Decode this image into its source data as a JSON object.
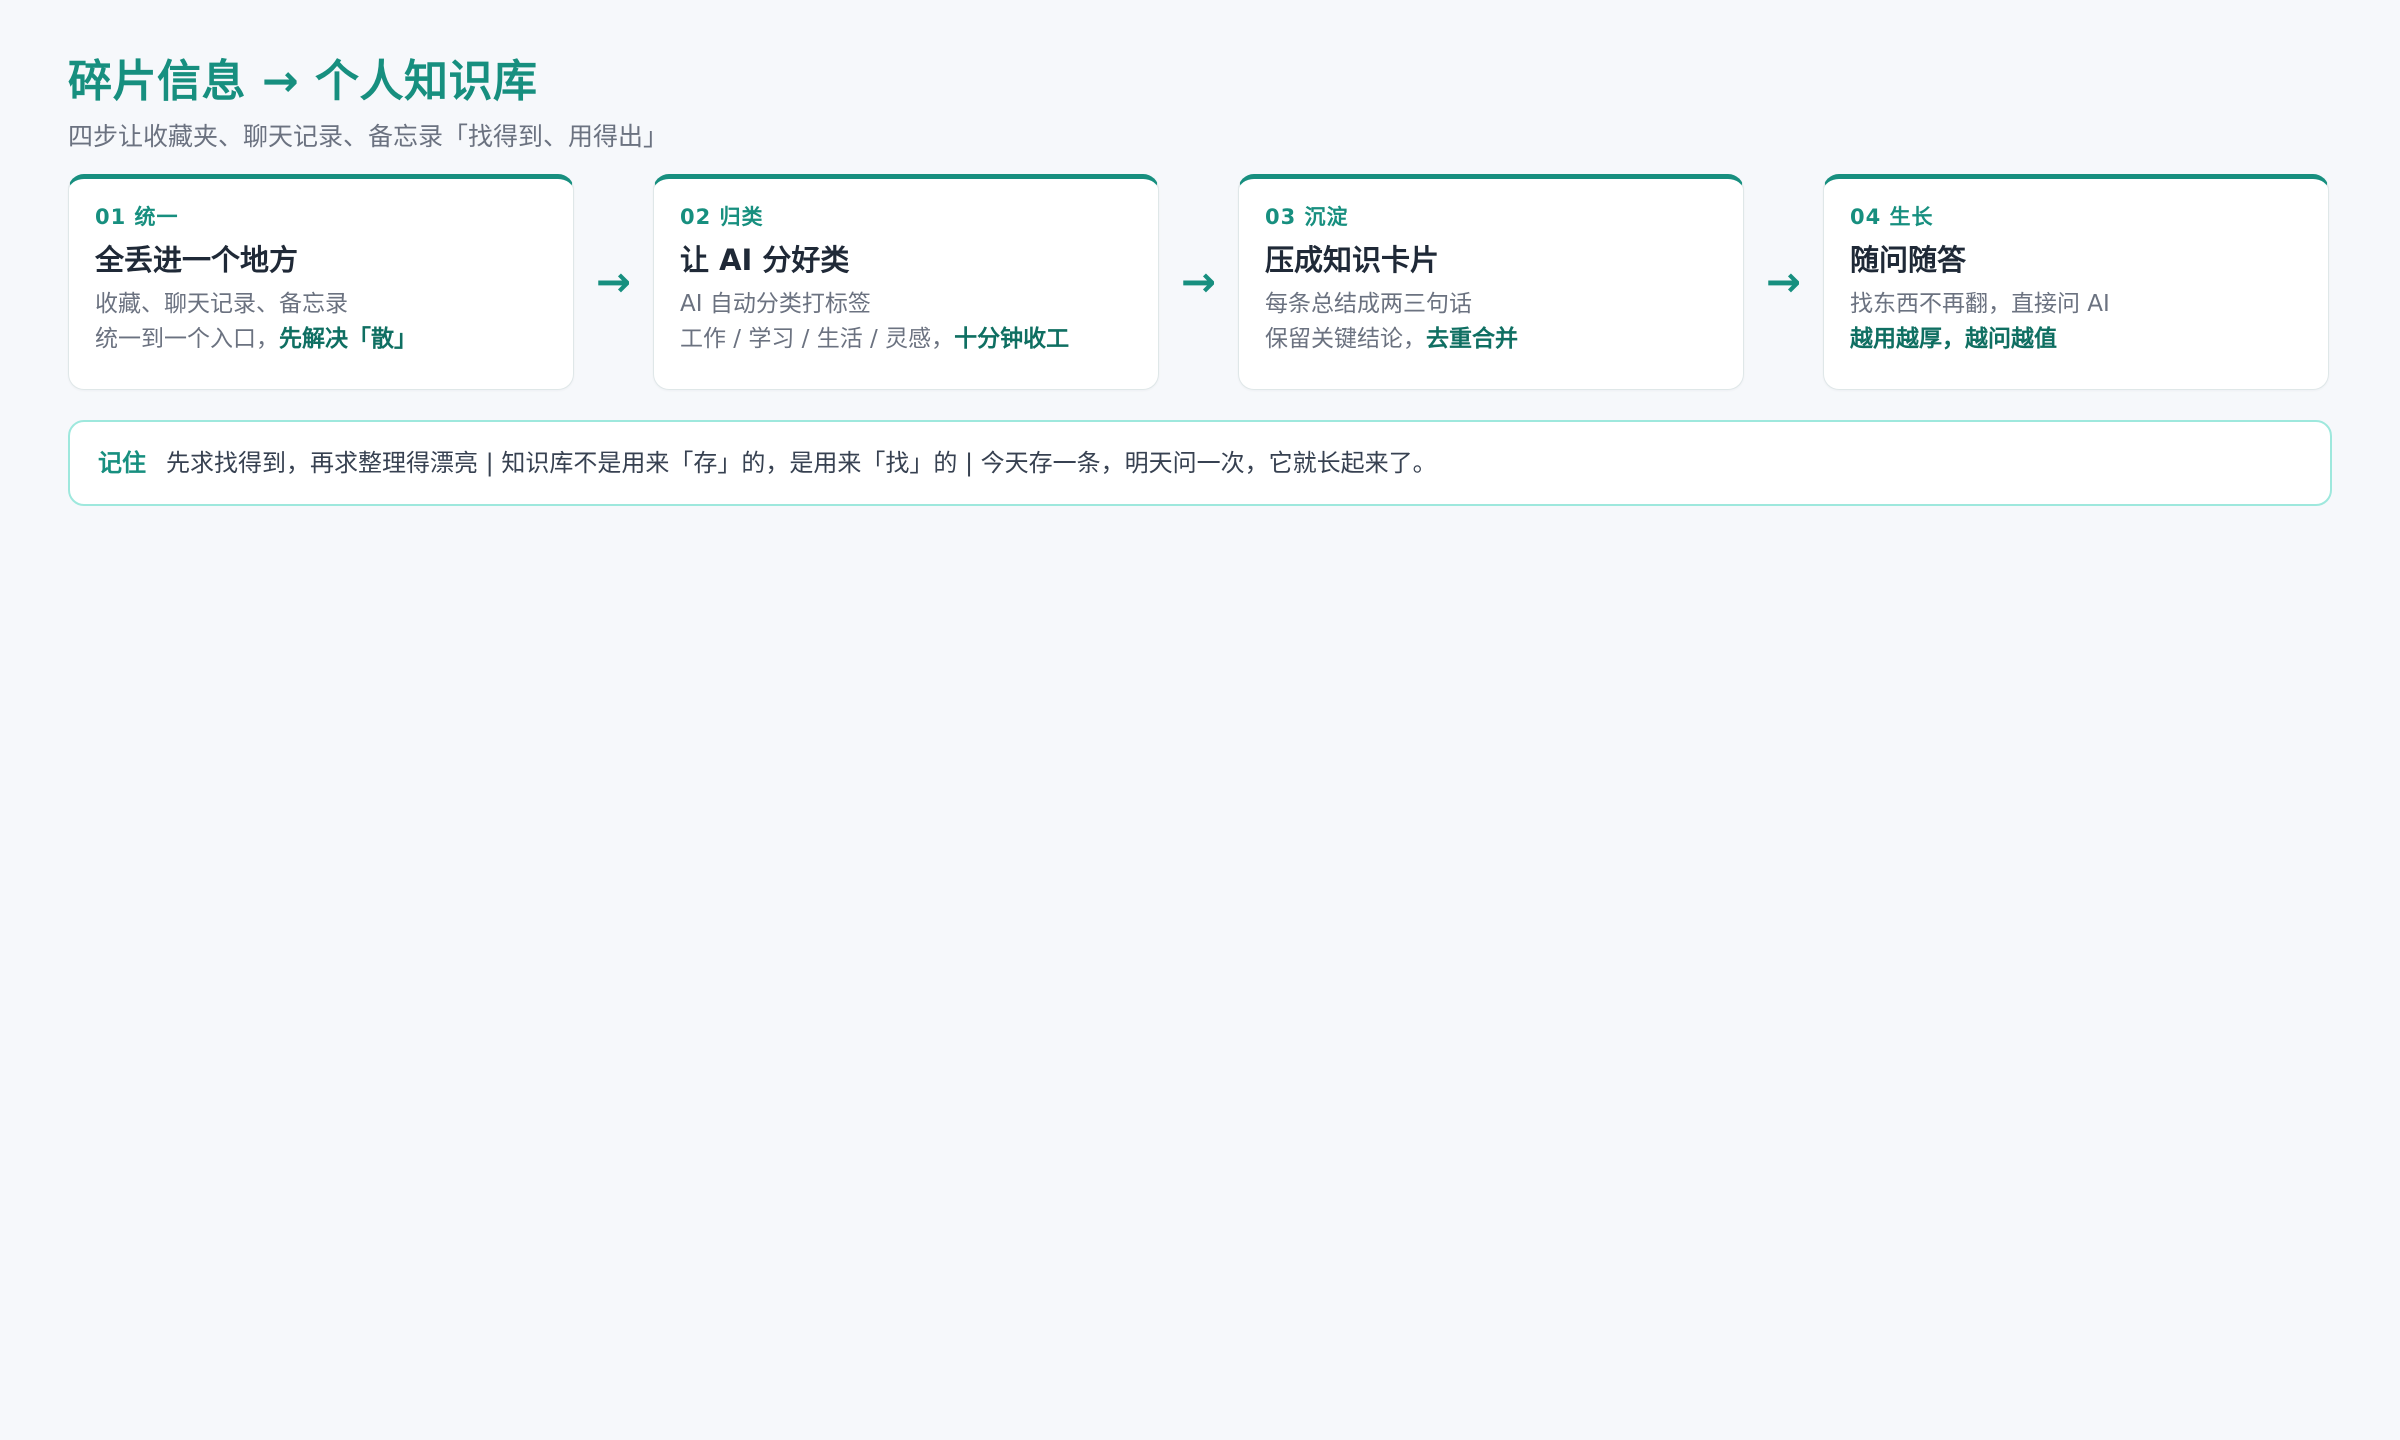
{
  "header": {
    "title": "碎片信息 → 个人知识库",
    "subtitle": "四步让收藏夹、聊天记录、备忘录「找得到、用得出」"
  },
  "steps": [
    {
      "tag": "01 统一",
      "title": "全丢进一个地方",
      "line1": "收藏、聊天记录、备忘录",
      "line2_prefix": "统一到一个入口，",
      "line2_emph": "先解决「散」"
    },
    {
      "tag": "02 归类",
      "title": "让 AI 分好类",
      "line1": "AI 自动分类打标签",
      "line2_prefix": "工作 / 学习 / 生活 / 灵感，",
      "line2_emph": "十分钟收工"
    },
    {
      "tag": "03 沉淀",
      "title": "压成知识卡片",
      "line1": "每条总结成两三句话",
      "line2_prefix": "保留关键结论，",
      "line2_emph": "去重合并"
    },
    {
      "tag": "04 生长",
      "title": "随问随答",
      "line1": "找东西不再翻，直接问 AI",
      "line2_prefix": "",
      "line2_emph": "越用越厚，越问越值"
    }
  ],
  "arrows": {
    "symbol": "→"
  },
  "note": {
    "label": "记住",
    "text": "先求找得到，再求整理得漂亮 | 知识库不是用来「存」的，是用来「找」的 | 今天存一条，明天问一次，它就长起来了。"
  },
  "colors": {
    "accent": "#178f7f",
    "accent_dark": "#0f6f62",
    "border": "#dfe7e8",
    "note_border": "#9ee8dd",
    "background": "#f6f8fb"
  }
}
